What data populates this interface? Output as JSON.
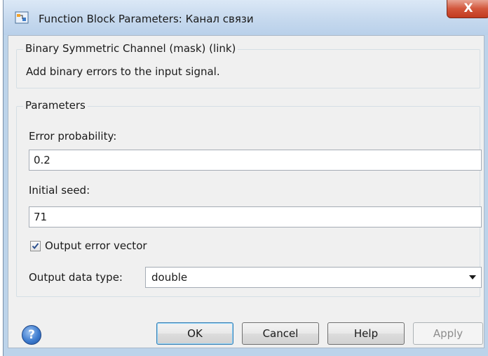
{
  "window": {
    "title": "Function Block Parameters: Канал связи",
    "close_label": "X"
  },
  "description": {
    "legend": "Binary Symmetric Channel (mask) (link)",
    "text": "Add binary errors to the input signal."
  },
  "parameters": {
    "legend": "Parameters",
    "error_probability": {
      "label": "Error probability:",
      "value": "0.2"
    },
    "initial_seed": {
      "label": "Initial seed:",
      "value": "71"
    },
    "output_error_vector": {
      "label": "Output error vector",
      "checked": true
    },
    "output_data_type": {
      "label": "Output data type:",
      "value": "double"
    }
  },
  "buttons": {
    "help_icon": "?",
    "ok": "OK",
    "cancel": "Cancel",
    "help": "Help",
    "apply": "Apply"
  }
}
